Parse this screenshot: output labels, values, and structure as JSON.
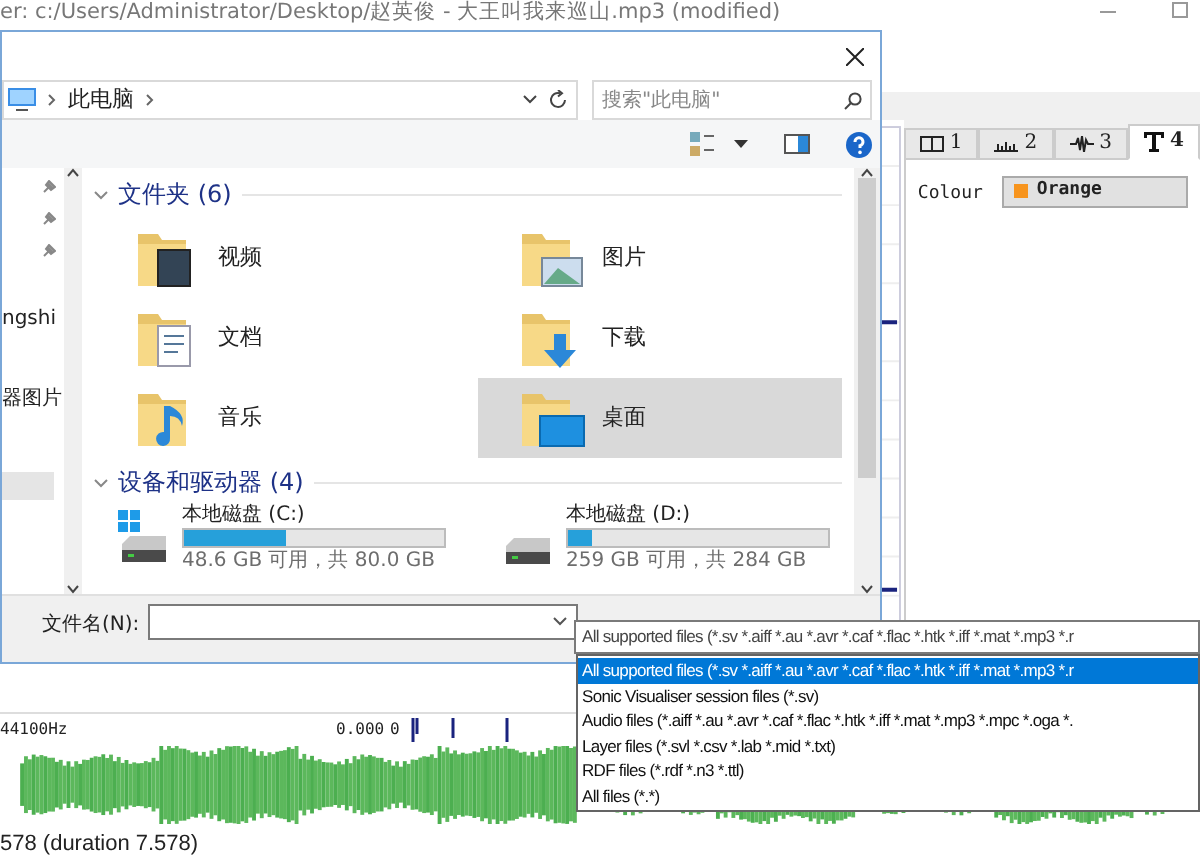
{
  "app": {
    "title": "er: c:/Users/Administrator/Desktop/赵英俊 - 大王叫我来巡山.mp3 (modified)",
    "tabs": [
      {
        "label": "1",
        "kind": "pane",
        "selected": false
      },
      {
        "label": "2",
        "kind": "bars",
        "selected": false
      },
      {
        "label": "3",
        "kind": "wave",
        "selected": false
      },
      {
        "label": "4",
        "kind": "text",
        "selected": true
      }
    ],
    "colour_label": "Colour",
    "colour_value": "Orange",
    "ruler": {
      "rate": "44100Hz",
      "value": "0.000",
      "zero": "0"
    },
    "status": "578 (duration 7.578)"
  },
  "dialog": {
    "address": "此电脑",
    "search_placeholder": "搜索\"此电脑\"",
    "nav_items": [
      {
        "label": "ngshi"
      },
      {
        "label": "器图片"
      }
    ],
    "folders_title": "文件夹 (6)",
    "folders": [
      {
        "label": "视频",
        "kind": "video",
        "selected": false
      },
      {
        "label": "图片",
        "kind": "pictures",
        "selected": false
      },
      {
        "label": "文档",
        "kind": "documents",
        "selected": false
      },
      {
        "label": "下载",
        "kind": "downloads",
        "selected": false
      },
      {
        "label": "音乐",
        "kind": "music",
        "selected": false
      },
      {
        "label": "桌面",
        "kind": "desktop",
        "selected": true
      }
    ],
    "drives_title": "设备和驱动器 (4)",
    "drives": [
      {
        "label": "本地磁盘 (C:)",
        "level": 0.39,
        "info": "48.6 GB 可用，共 80.0 GB",
        "system": true
      },
      {
        "label": "本地磁盘 (D:)",
        "level": 0.09,
        "info": "259 GB 可用，共 284 GB",
        "system": false
      }
    ],
    "filename_label": "文件名(N):",
    "filetype": "All supported files (*.sv *.aiff *.au *.avr *.caf *.flac *.htk *.iff *.mat *.mp3 *.r",
    "filetype_options": [
      {
        "label": "All supported files (*.sv *.aiff *.au *.avr *.caf *.flac *.htk *.iff *.mat *.mp3 *.r",
        "selected": true
      },
      {
        "label": "Sonic Visualiser session files (*.sv)",
        "selected": false
      },
      {
        "label": "Audio files (*.aiff *.au *.avr *.caf *.flac *.htk *.iff *.mat *.mp3 *.mpc *.oga *.",
        "selected": false
      },
      {
        "label": "Layer files (*.svl *.csv *.lab *.mid *.txt)",
        "selected": false
      },
      {
        "label": "RDF files (*.rdf *.n3 *.ttl)",
        "selected": false
      },
      {
        "label": "All files (*.*)",
        "selected": false
      }
    ]
  }
}
